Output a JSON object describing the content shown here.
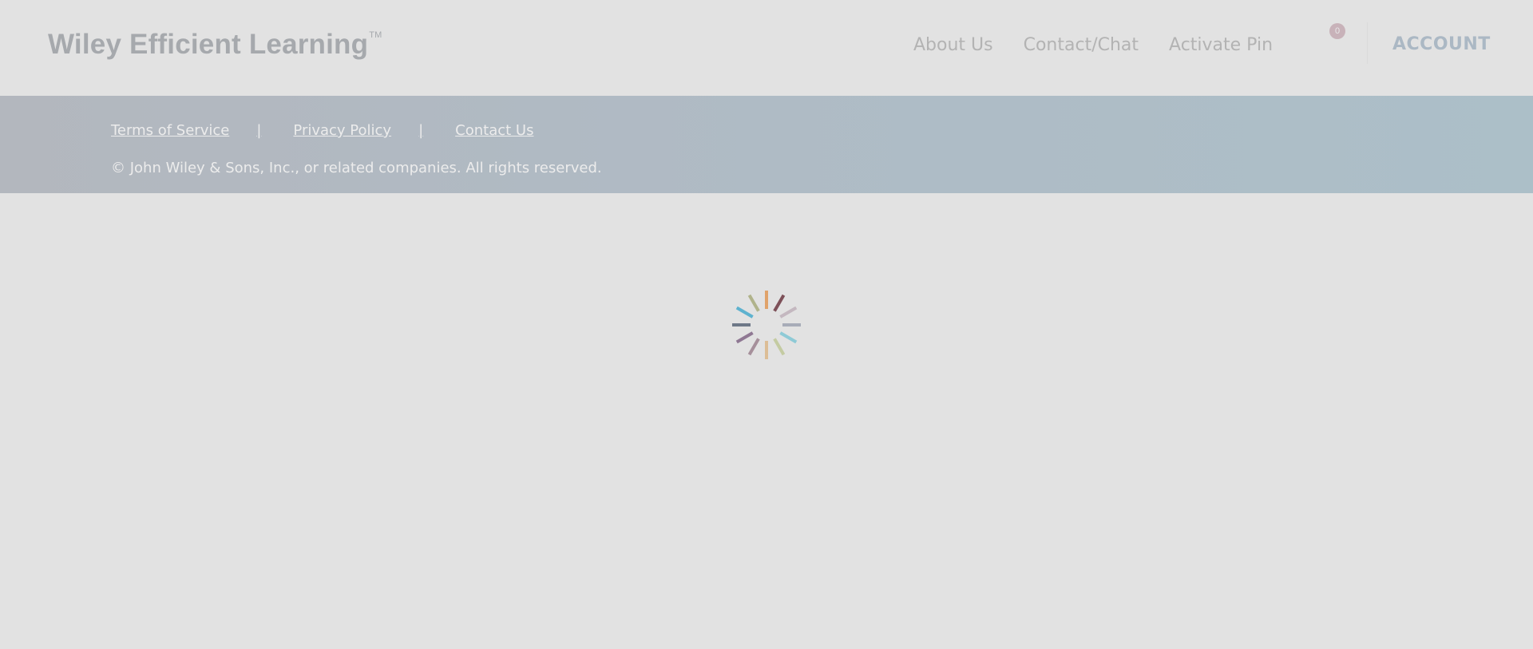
{
  "header": {
    "logo_text": "Wiley Efficient Learning",
    "logo_tm": "TM",
    "nav": [
      {
        "label": "About Us"
      },
      {
        "label": "Contact/Chat"
      },
      {
        "label": "Activate Pin"
      }
    ],
    "cart_count": "0",
    "account_label": "ACCOUNT"
  },
  "footer": {
    "links": [
      {
        "label": "Terms of Service"
      },
      {
        "label": "Privacy Policy"
      },
      {
        "label": "Contact Us"
      }
    ],
    "separator": "|",
    "copyright": "© John Wiley & Sons, Inc., or related companies. All rights reserved."
  },
  "spinner": {
    "icon": "loading-spinner-icon",
    "colors": [
      "#e0a36a",
      "#7d5058",
      "#c4b8c0",
      "#a7acb8",
      "#8ecad6",
      "#c4cba2",
      "#dcbd96",
      "#a6909b",
      "#8f7893",
      "#6e7888",
      "#5eb2cf",
      "#b0b38b"
    ]
  }
}
